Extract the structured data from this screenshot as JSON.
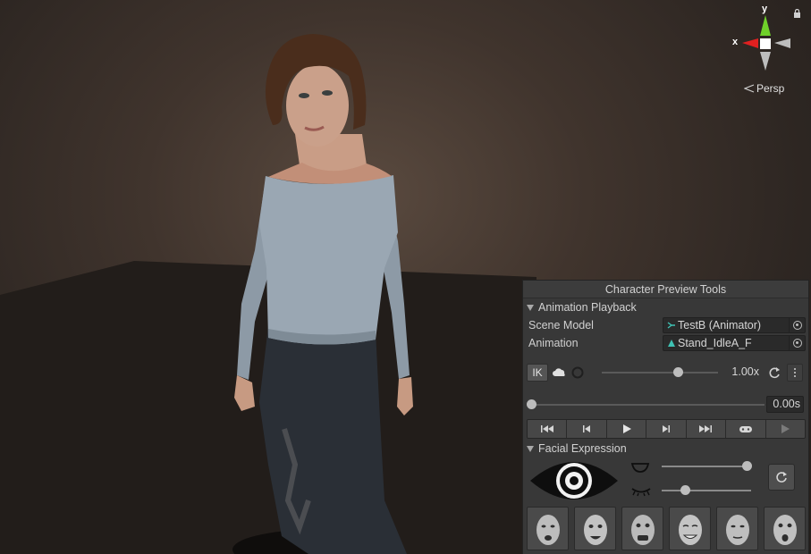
{
  "gizmo": {
    "y_label": "y",
    "x_label": "x",
    "projection": "Persp",
    "icons": [
      "lock-icon"
    ]
  },
  "panel": {
    "title": "Character Preview Tools",
    "animation_playback": {
      "header": "Animation Playback",
      "scene_model_label": "Scene Model",
      "scene_model_value": "TestB (Animator)",
      "animation_label": "Animation",
      "animation_value": "Stand_IdleA_F",
      "ik_label": "IK",
      "speed": 0.5,
      "speed_text": "1.00x",
      "time": 0.0,
      "time_text": "0.00s",
      "transport_icons": [
        "skip-start-icon",
        "step-back-icon",
        "play-icon",
        "step-forward-icon",
        "skip-end-icon",
        "gamepad-icon",
        "play-outline-icon"
      ]
    },
    "facial_expression": {
      "header": "Facial Expression",
      "mouth_level": 0.95,
      "blink_level": 0.25,
      "faces": [
        "face-neutral",
        "face-surprise",
        "face-fear",
        "face-smile",
        "face-calm",
        "face-shock"
      ]
    }
  },
  "colors": {
    "panel_bg": "#383838",
    "axis_y": "#6fd12a",
    "axis_x": "#e02020",
    "accent_teal": "#3fc2b4"
  }
}
